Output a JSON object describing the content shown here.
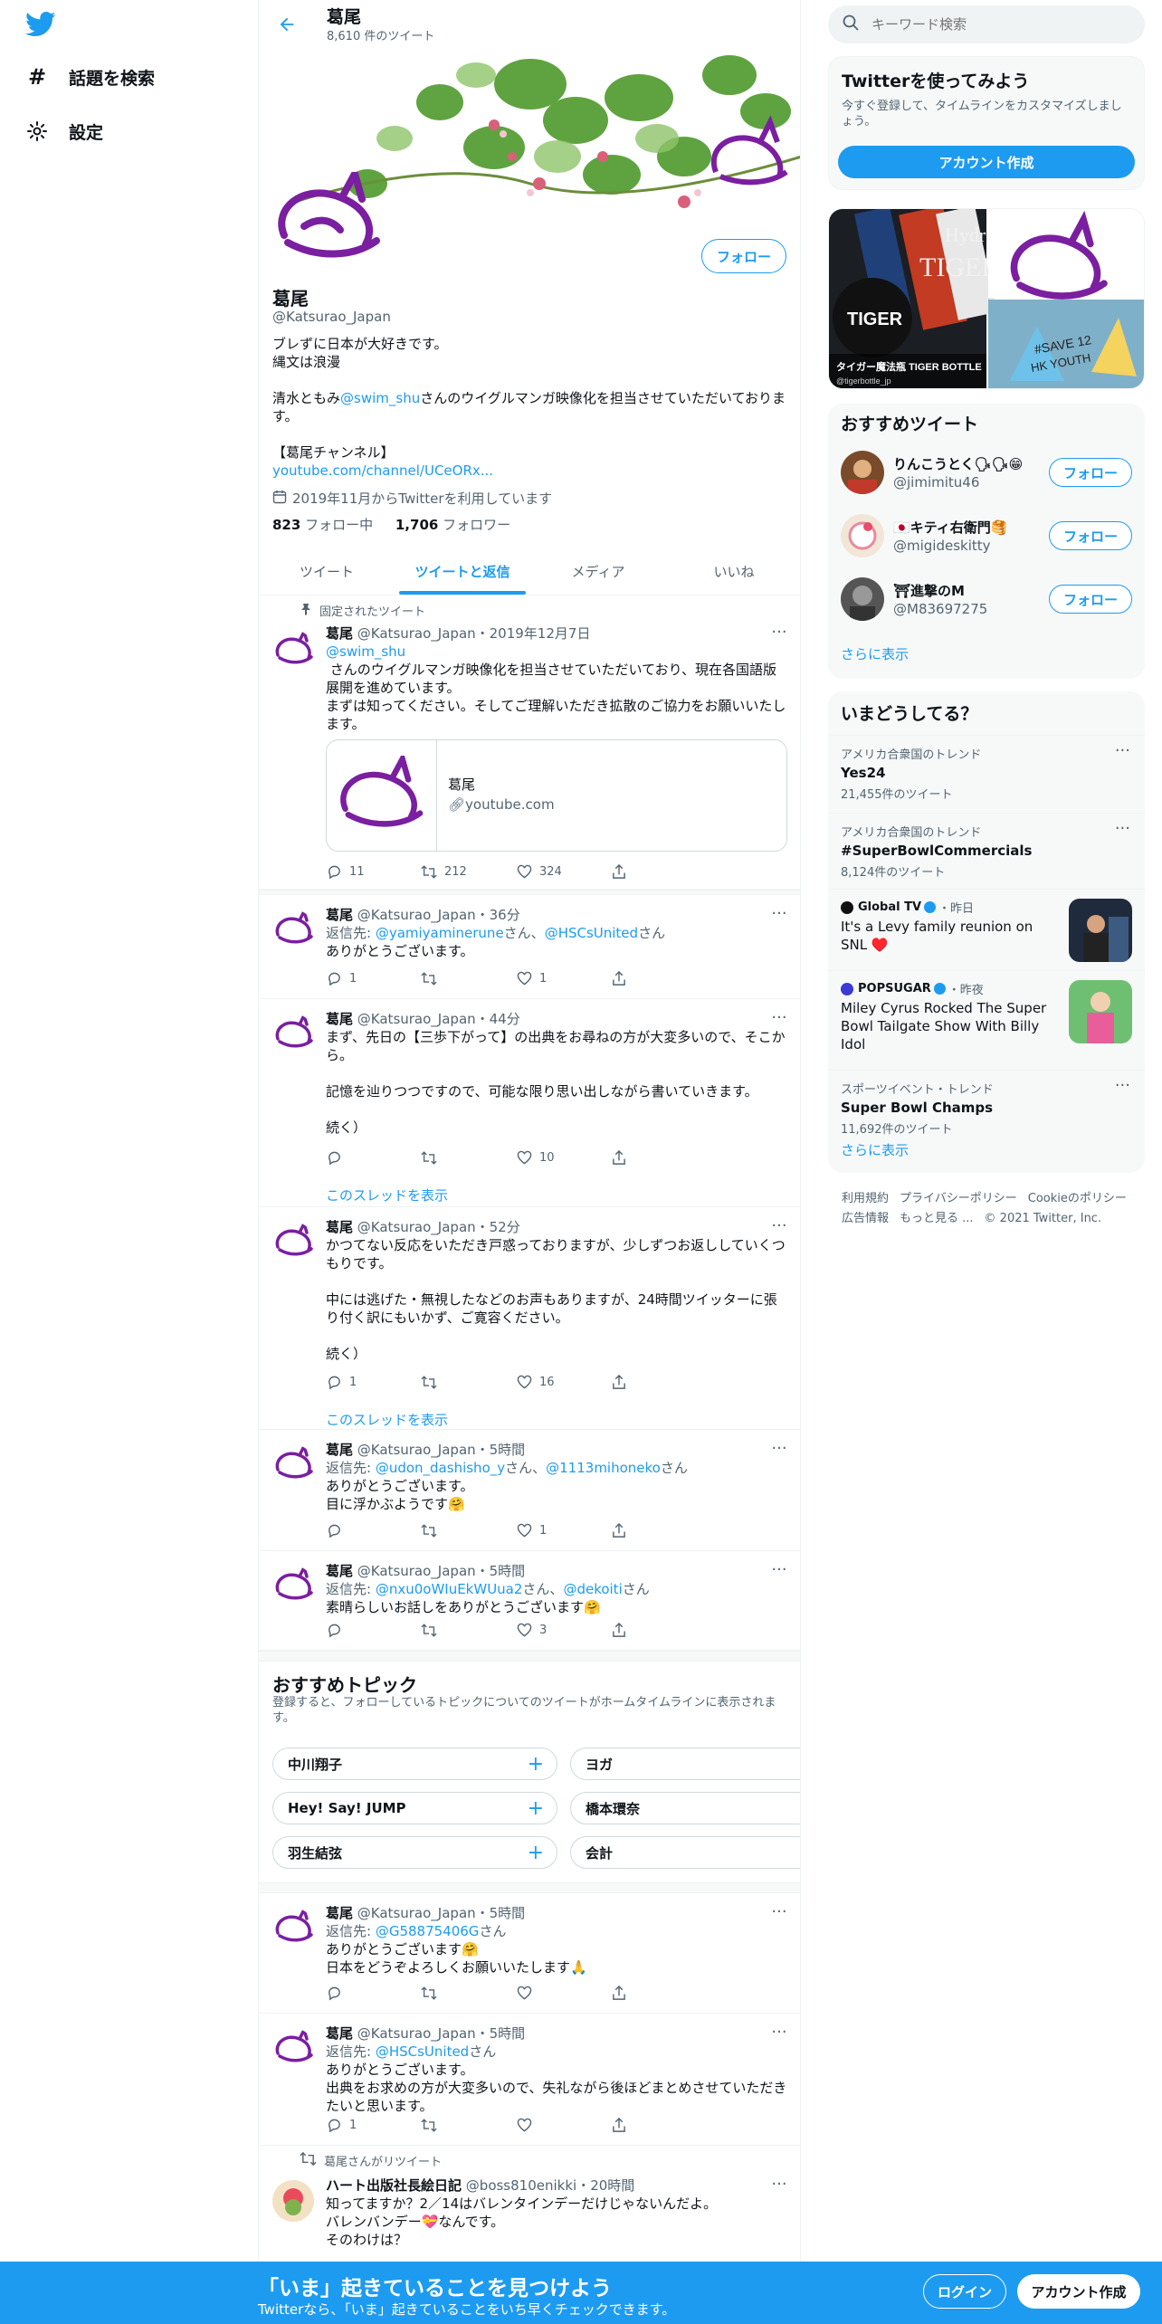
{
  "nav": {
    "explore": "話題を検索",
    "settings": "設定"
  },
  "header": {
    "name": "葛尾",
    "tweet_count": "8,610 件のツイート"
  },
  "profile": {
    "follow": "フォロー",
    "name": "葛尾",
    "handle": "@Katsurao_Japan",
    "bio1": "ブレずに日本が大好きです。",
    "bio2": "縄文は浪漫",
    "bio3a": "清水ともみ",
    "bio3link": "@swim_shu",
    "bio3b": "さんのウイグルマンガ映像化を担当させていただいております。",
    "bio4": "【葛尾チャンネル】",
    "bio5": "youtube.com/channel/UCeORx...",
    "joined": "2019年11月からTwitterを利用しています",
    "following_count": "823",
    "following_label": " フォロー中",
    "followers_count": "1,706",
    "followers_label": " フォロワー"
  },
  "tabs": [
    "ツイート",
    "ツイートと返信",
    "メディア",
    "いいね"
  ],
  "pinned": {
    "label": "固定されたツイート",
    "name": "葛尾",
    "meta": "@Katsurao_Japan・2019年12月7日",
    "mention": "@swim_shu",
    "text": " さんのウイグルマンガ映像化を担当させていただいており、現在各国語版展開を進めています。\nまずは知ってください。そしてご理解いただき拡散のご協力をお願いいたします。",
    "card_title": "葛尾",
    "card_domain": "youtube.com",
    "replies": "11",
    "retweets": "212",
    "likes": "324"
  },
  "tweets": [
    {
      "name": "葛尾",
      "meta": "@Katsurao_Japan・36分",
      "reply_prefix": "返信先: ",
      "reply_to1": "@yamiyaminerune",
      "reply_mid": "さん、",
      "reply_to2": "@HSCsUnited",
      "reply_suffix": "さん",
      "text": "ありがとうございます。",
      "replies": "1",
      "retweets": "",
      "likes": "1"
    },
    {
      "name": "葛尾",
      "meta": "@Katsurao_Japan・44分",
      "text": "まず、先日の【三歩下がって】の出典をお尋ねの方が大変多いので、そこから。\n\n記憶を辿りつつですので、可能な限り思い出しながら書いていきます。\n\n続く）",
      "replies": "",
      "retweets": "",
      "likes": "10",
      "thread": "このスレッドを表示"
    },
    {
      "name": "葛尾",
      "meta": "@Katsurao_Japan・52分",
      "text": "かつてない反応をいただき戸惑っておりますが、少しずつお返ししていくつもりです。\n\n中には逃げた・無視したなどのお声もありますが、24時間ツイッターに張り付く訳にもいかず、ご寛容ください。\n\n続く）",
      "replies": "1",
      "retweets": "",
      "likes": "16",
      "thread": "このスレッドを表示"
    },
    {
      "name": "葛尾",
      "meta": "@Katsurao_Japan・5時間",
      "reply_prefix": "返信先: ",
      "reply_to1": "@udon_dashisho_y",
      "reply_mid": "さん、",
      "reply_to2": "@1113mihoneko",
      "reply_suffix": "さん",
      "text": "ありがとうございます。\n目に浮かぶようです🤗",
      "replies": "",
      "retweets": "",
      "likes": "1"
    },
    {
      "name": "葛尾",
      "meta": "@Katsurao_Japan・5時間",
      "reply_prefix": "返信先: ",
      "reply_to1": "@nxu0oWIuEkWUua2",
      "reply_mid": "さん、",
      "reply_to2": "@dekoiti",
      "reply_suffix": "さん",
      "text": "素晴らしいお話しをありがとうございます🤗",
      "replies": "",
      "retweets": "",
      "likes": "3"
    },
    {
      "name": "葛尾",
      "meta": "@Katsurao_Japan・5時間",
      "reply_prefix": "返信先: ",
      "reply_to1": "@G58875406G",
      "reply_mid": "",
      "reply_to2": "",
      "reply_suffix": "さん",
      "text": "ありがとうございます🤗\n日本をどうぞよろしくお願いいたします🙏",
      "replies": "",
      "retweets": "",
      "likes": ""
    },
    {
      "name": "葛尾",
      "meta": "@Katsurao_Japan・5時間",
      "reply_prefix": "返信先: ",
      "reply_to1": "@HSCsUnited",
      "reply_mid": "",
      "reply_to2": "",
      "reply_suffix": "さん",
      "text": "ありがとうございます。\n出典をお求めの方が大変多いので、失礼ながら後ほどまとめさせていただきたいと思います。",
      "replies": "1",
      "retweets": "",
      "likes": ""
    },
    {
      "rt_label": "葛尾さんがリツイート",
      "name": "ハート出版社長絵日記",
      "meta": "@boss810enikki・20時間",
      "text": "知ってますか？2／14はバレンタインデーだけじゃないんだよ。\nバレンバンデー💝なんです。\nそのわけは？"
    }
  ],
  "topics": {
    "title": "おすすめトピック",
    "sub": "登録すると、フォローしているトピックについてのツイートがホームタイムラインに表示されます。",
    "items": [
      "中川翔子",
      "ヨガ",
      "Hey! Say! JUMP",
      "橋本環奈",
      "羽生結弦",
      "会計"
    ]
  },
  "search": {
    "placeholder": "キーワード検索"
  },
  "signup_box": {
    "title": "Twitterを使ってみよう",
    "text": "今すぐ登録して、タイムラインをカスタマイズしましょう。",
    "button": "アカウント作成"
  },
  "media": {
    "caption": "タイガー魔法瓶 TIGER BOTTLE",
    "handle": "@tigerbottle_jp",
    "brand": "TIGER",
    "tiger_text": "TIGER",
    "hydrate": "Hydrate",
    "save": "#SAVE 12",
    "hk": "HK YOUTH"
  },
  "suggested": {
    "title": "おすすめツイート",
    "follow": "フォロー",
    "more": "さらに表示",
    "users": [
      {
        "name": "りんこうとく🗣🗣😁",
        "handle": "@jimimitu46"
      },
      {
        "name": "🇯🇵キティ右衛門🥞",
        "handle": "@migideskitty"
      },
      {
        "name": "⛩進撃のM",
        "handle": "@M83697275"
      }
    ]
  },
  "trends": {
    "title": "いまどうしてる？",
    "more": "さらに表示",
    "items": [
      {
        "ctx": "アメリカ合衆国のトレンド",
        "title": "Yes24",
        "count": "21,455件のツイート"
      },
      {
        "ctx": "アメリカ合衆国のトレンド",
        "title": "#SuperBowlCommercials",
        "count": "8,124件のツイート"
      },
      {
        "ctx_source": "Global TV",
        "ctx_time": "・昨日",
        "title": "It's a Levy family reunion on SNL ♥️"
      },
      {
        "ctx_source": "POPSUGAR",
        "ctx_time": "・昨夜",
        "title": "Miley Cyrus Rocked The Super Bowl Tailgate Show With Billy Idol"
      },
      {
        "ctx": "スポーツイベント・トレンド",
        "title": "Super Bowl Champs",
        "count": "11,692件のツイート"
      }
    ]
  },
  "footer": {
    "l1": "利用規約",
    "l2": "プライバシーポリシー",
    "l3": "Cookieのポリシー",
    "l4": "広告情報",
    "l5": "もっと見る ...",
    "l6": "© 2021 Twitter, Inc."
  },
  "bottom": {
    "title": "「いま」起きていることを見つけよう",
    "sub": "Twitterなら、「いま」起きていることをいち早くチェックできます。",
    "login": "ログイン",
    "signup": "アカウント作成"
  },
  "colors": {
    "accent": "#1d9bf0",
    "text": "#0f1419",
    "secondary": "#536471",
    "border": "#eff3f4",
    "avatar_purple": "#7a1fa0"
  }
}
